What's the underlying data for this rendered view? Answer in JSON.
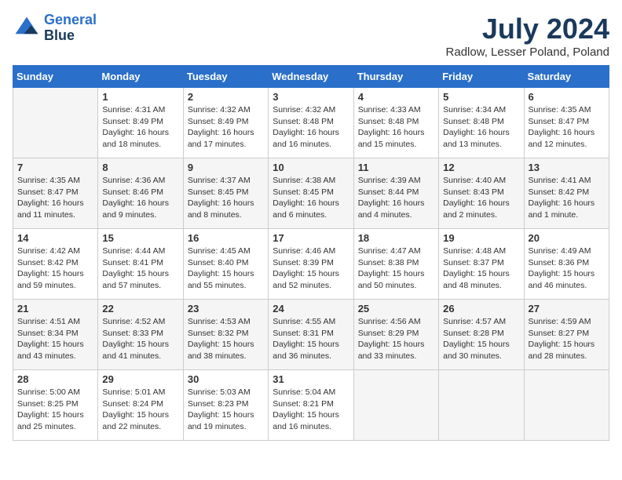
{
  "header": {
    "logo_line1": "General",
    "logo_line2": "Blue",
    "month_year": "July 2024",
    "location": "Radlow, Lesser Poland, Poland"
  },
  "days_of_week": [
    "Sunday",
    "Monday",
    "Tuesday",
    "Wednesday",
    "Thursday",
    "Friday",
    "Saturday"
  ],
  "weeks": [
    [
      {
        "day": "",
        "info": ""
      },
      {
        "day": "1",
        "info": "Sunrise: 4:31 AM\nSunset: 8:49 PM\nDaylight: 16 hours\nand 18 minutes."
      },
      {
        "day": "2",
        "info": "Sunrise: 4:32 AM\nSunset: 8:49 PM\nDaylight: 16 hours\nand 17 minutes."
      },
      {
        "day": "3",
        "info": "Sunrise: 4:32 AM\nSunset: 8:48 PM\nDaylight: 16 hours\nand 16 minutes."
      },
      {
        "day": "4",
        "info": "Sunrise: 4:33 AM\nSunset: 8:48 PM\nDaylight: 16 hours\nand 15 minutes."
      },
      {
        "day": "5",
        "info": "Sunrise: 4:34 AM\nSunset: 8:48 PM\nDaylight: 16 hours\nand 13 minutes."
      },
      {
        "day": "6",
        "info": "Sunrise: 4:35 AM\nSunset: 8:47 PM\nDaylight: 16 hours\nand 12 minutes."
      }
    ],
    [
      {
        "day": "7",
        "info": "Sunrise: 4:35 AM\nSunset: 8:47 PM\nDaylight: 16 hours\nand 11 minutes."
      },
      {
        "day": "8",
        "info": "Sunrise: 4:36 AM\nSunset: 8:46 PM\nDaylight: 16 hours\nand 9 minutes."
      },
      {
        "day": "9",
        "info": "Sunrise: 4:37 AM\nSunset: 8:45 PM\nDaylight: 16 hours\nand 8 minutes."
      },
      {
        "day": "10",
        "info": "Sunrise: 4:38 AM\nSunset: 8:45 PM\nDaylight: 16 hours\nand 6 minutes."
      },
      {
        "day": "11",
        "info": "Sunrise: 4:39 AM\nSunset: 8:44 PM\nDaylight: 16 hours\nand 4 minutes."
      },
      {
        "day": "12",
        "info": "Sunrise: 4:40 AM\nSunset: 8:43 PM\nDaylight: 16 hours\nand 2 minutes."
      },
      {
        "day": "13",
        "info": "Sunrise: 4:41 AM\nSunset: 8:42 PM\nDaylight: 16 hours\nand 1 minute."
      }
    ],
    [
      {
        "day": "14",
        "info": "Sunrise: 4:42 AM\nSunset: 8:42 PM\nDaylight: 15 hours\nand 59 minutes."
      },
      {
        "day": "15",
        "info": "Sunrise: 4:44 AM\nSunset: 8:41 PM\nDaylight: 15 hours\nand 57 minutes."
      },
      {
        "day": "16",
        "info": "Sunrise: 4:45 AM\nSunset: 8:40 PM\nDaylight: 15 hours\nand 55 minutes."
      },
      {
        "day": "17",
        "info": "Sunrise: 4:46 AM\nSunset: 8:39 PM\nDaylight: 15 hours\nand 52 minutes."
      },
      {
        "day": "18",
        "info": "Sunrise: 4:47 AM\nSunset: 8:38 PM\nDaylight: 15 hours\nand 50 minutes."
      },
      {
        "day": "19",
        "info": "Sunrise: 4:48 AM\nSunset: 8:37 PM\nDaylight: 15 hours\nand 48 minutes."
      },
      {
        "day": "20",
        "info": "Sunrise: 4:49 AM\nSunset: 8:36 PM\nDaylight: 15 hours\nand 46 minutes."
      }
    ],
    [
      {
        "day": "21",
        "info": "Sunrise: 4:51 AM\nSunset: 8:34 PM\nDaylight: 15 hours\nand 43 minutes."
      },
      {
        "day": "22",
        "info": "Sunrise: 4:52 AM\nSunset: 8:33 PM\nDaylight: 15 hours\nand 41 minutes."
      },
      {
        "day": "23",
        "info": "Sunrise: 4:53 AM\nSunset: 8:32 PM\nDaylight: 15 hours\nand 38 minutes."
      },
      {
        "day": "24",
        "info": "Sunrise: 4:55 AM\nSunset: 8:31 PM\nDaylight: 15 hours\nand 36 minutes."
      },
      {
        "day": "25",
        "info": "Sunrise: 4:56 AM\nSunset: 8:29 PM\nDaylight: 15 hours\nand 33 minutes."
      },
      {
        "day": "26",
        "info": "Sunrise: 4:57 AM\nSunset: 8:28 PM\nDaylight: 15 hours\nand 30 minutes."
      },
      {
        "day": "27",
        "info": "Sunrise: 4:59 AM\nSunset: 8:27 PM\nDaylight: 15 hours\nand 28 minutes."
      }
    ],
    [
      {
        "day": "28",
        "info": "Sunrise: 5:00 AM\nSunset: 8:25 PM\nDaylight: 15 hours\nand 25 minutes."
      },
      {
        "day": "29",
        "info": "Sunrise: 5:01 AM\nSunset: 8:24 PM\nDaylight: 15 hours\nand 22 minutes."
      },
      {
        "day": "30",
        "info": "Sunrise: 5:03 AM\nSunset: 8:23 PM\nDaylight: 15 hours\nand 19 minutes."
      },
      {
        "day": "31",
        "info": "Sunrise: 5:04 AM\nSunset: 8:21 PM\nDaylight: 15 hours\nand 16 minutes."
      },
      {
        "day": "",
        "info": ""
      },
      {
        "day": "",
        "info": ""
      },
      {
        "day": "",
        "info": ""
      }
    ]
  ]
}
